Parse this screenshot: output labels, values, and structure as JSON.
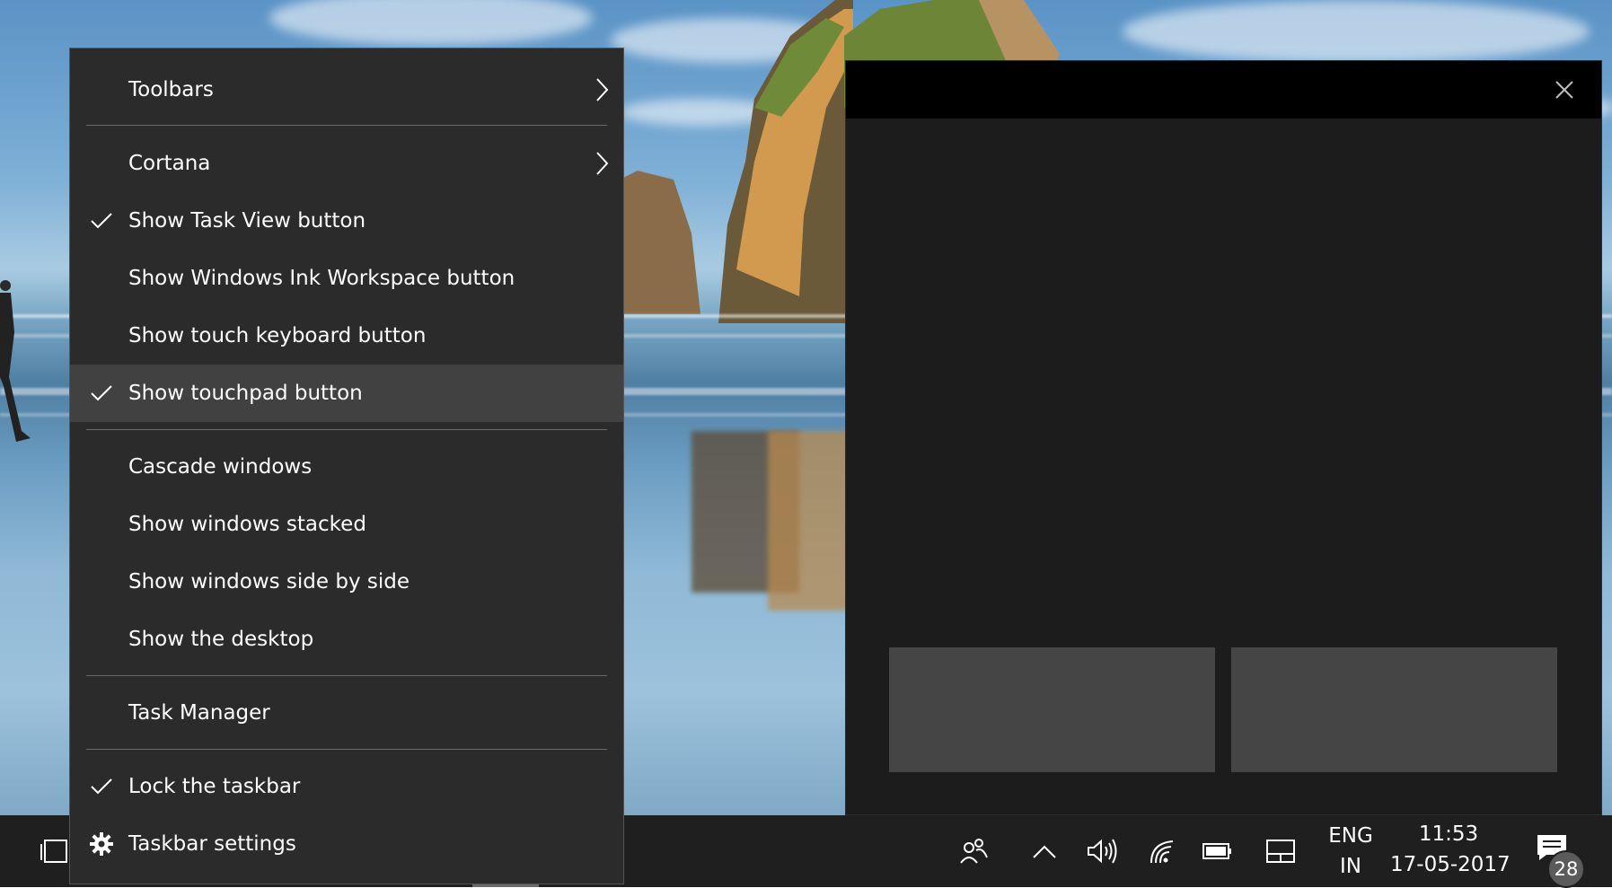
{
  "context_menu": {
    "items": [
      {
        "label": "Toolbars",
        "has_submenu": true,
        "checked": false
      },
      {
        "label": "Cortana",
        "has_submenu": true,
        "checked": false
      },
      {
        "label": "Show Task View button",
        "checked": true
      },
      {
        "label": "Show Windows Ink Workspace button",
        "checked": false
      },
      {
        "label": "Show touch keyboard button",
        "checked": false
      },
      {
        "label": "Show touchpad button",
        "checked": true,
        "highlighted": true
      },
      {
        "label": "Cascade windows",
        "checked": false
      },
      {
        "label": "Show windows stacked",
        "checked": false
      },
      {
        "label": "Show windows side by side",
        "checked": false
      },
      {
        "label": "Show the desktop",
        "checked": false
      },
      {
        "label": "Task Manager",
        "checked": false
      },
      {
        "label": "Lock the taskbar",
        "checked": true
      },
      {
        "label": "Taskbar settings",
        "icon": "gear-icon"
      }
    ]
  },
  "touchpad_window": {
    "close_icon": "close-icon",
    "left_button_icon": "none",
    "right_button_icon": "none"
  },
  "taskbar": {
    "language": {
      "line1": "ENG",
      "line2": "IN"
    },
    "clock": {
      "time": "11:53",
      "date": "17-05-2017"
    },
    "notifications_count": "28",
    "icons": [
      "task-view-icon",
      "people-icon",
      "chevron-up-icon",
      "volume-icon",
      "wifi-icon",
      "battery-icon",
      "touchpad-icon",
      "action-center-icon"
    ]
  },
  "colors": {
    "menu_bg": "#2b2b2b",
    "menu_highlight": "#414141",
    "taskbar_bg": "#1f1f1f",
    "touchpad_bg": "#1c1c1c",
    "touchpad_button": "#454545"
  }
}
